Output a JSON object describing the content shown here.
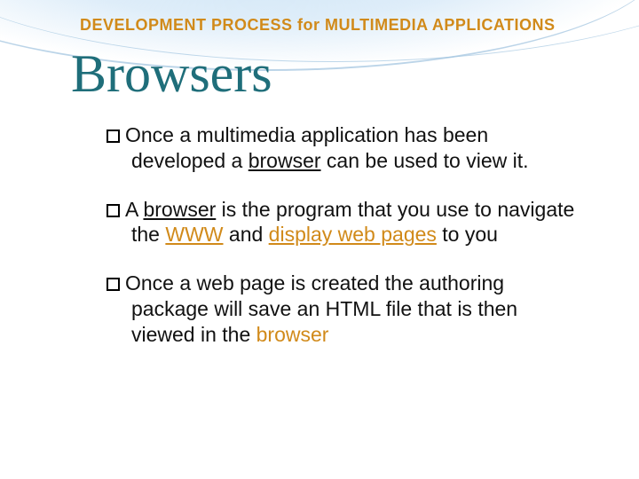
{
  "header": "DEVELOPMENT PROCESS for MULTIMEDIA APPLICATIONS",
  "title": "Browsers",
  "bullets": {
    "b1": {
      "t1": "Once a multimedia application has been developed a ",
      "t2": "browser",
      "t3": " can be used to view it."
    },
    "b2": {
      "t1": "A ",
      "t2": "browser",
      "t3": " is the program that you use to navigate the ",
      "t4": "WWW",
      "t5": " and ",
      "t6": "display web pages",
      "t7": " to you"
    },
    "b3": {
      "t1": "Once a web page is created the authoring package will save an HTML file that is then viewed in the ",
      "t2": "browser"
    }
  }
}
